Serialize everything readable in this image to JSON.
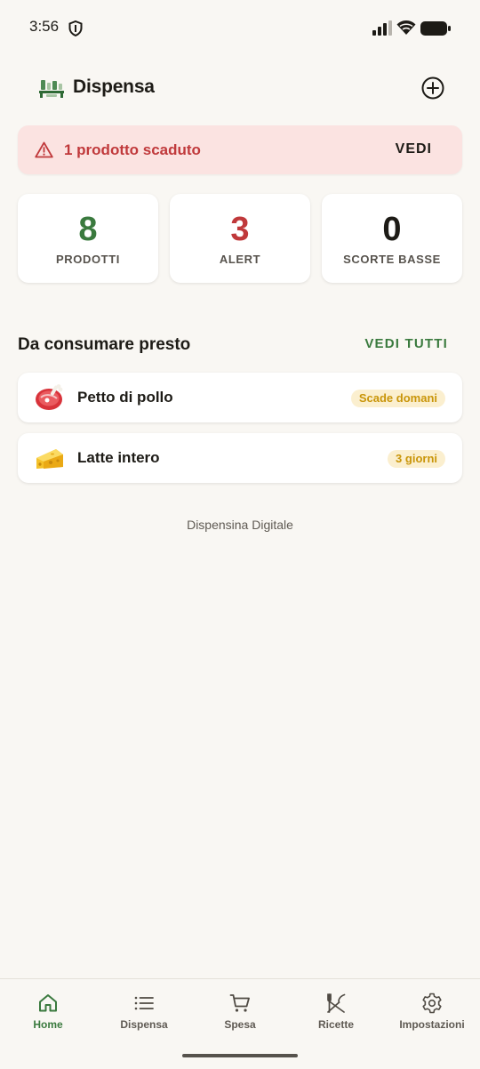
{
  "status_bar": {
    "time": "3:56"
  },
  "header": {
    "title": "Dispensa",
    "logo_icon": "pantry-shelf-icon",
    "add_icon": "add-circle-icon"
  },
  "alert": {
    "text": "1 prodotto scaduto",
    "action": "VEDI",
    "icon": "warning-icon",
    "color": "#c0393b"
  },
  "stats": [
    {
      "value": "8",
      "label": "PRODOTTI",
      "color": "#3a7a3e"
    },
    {
      "value": "3",
      "label": "ALERT",
      "color": "#c0393b"
    },
    {
      "value": "0",
      "label": "SCORTE BASSE",
      "color": "#1d1b16"
    }
  ],
  "section": {
    "title": "Da consumare presto",
    "action": "VEDI TUTTI"
  },
  "products": [
    {
      "name": "Petto di pollo",
      "icon": "meat-icon",
      "badge": "Scade domani"
    },
    {
      "name": "Latte intero",
      "icon": "cheese-icon",
      "badge": "3 giorni"
    }
  ],
  "footer": {
    "text": "Dispensina Digitale"
  },
  "nav": [
    {
      "label": "Home",
      "icon": "home-icon",
      "active": true
    },
    {
      "label": "Dispensa",
      "icon": "list-icon",
      "active": false
    },
    {
      "label": "Spesa",
      "icon": "cart-icon",
      "active": false
    },
    {
      "label": "Ricette",
      "icon": "utensils-icon",
      "active": false
    },
    {
      "label": "Impostazioni",
      "icon": "gear-icon",
      "active": false
    }
  ],
  "colors": {
    "accent": "#3a7a3e",
    "danger": "#c0393b",
    "warning": "#c99509",
    "background": "#f9f7f3"
  }
}
